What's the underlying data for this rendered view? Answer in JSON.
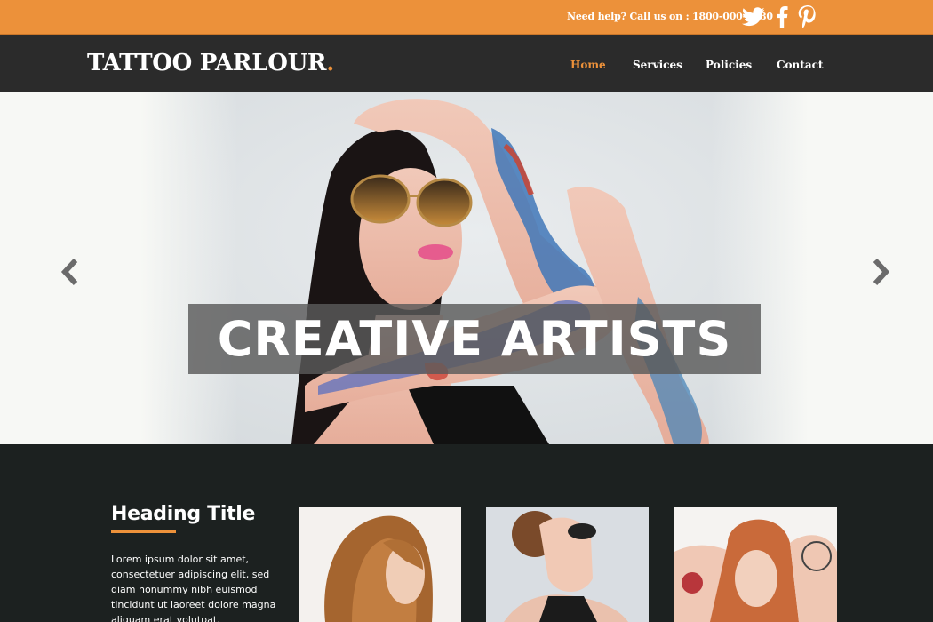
{
  "topbar": {
    "help_text": "Need help? Call us on : 1800-000-8080",
    "social": [
      {
        "name": "twitter-icon"
      },
      {
        "name": "facebook-icon"
      },
      {
        "name": "pinterest-icon"
      }
    ]
  },
  "header": {
    "logo_text": "TATTOO PARLOUR",
    "logo_dot": ".",
    "nav": [
      {
        "label": "Home",
        "active": true
      },
      {
        "label": "Services",
        "active": false
      },
      {
        "label": "Policies",
        "active": false
      },
      {
        "label": "Contact",
        "active": false
      }
    ]
  },
  "hero": {
    "caption": "CREATIVE ARTISTS",
    "prev_icon": "chevron-left-icon",
    "next_icon": "chevron-right-icon"
  },
  "content": {
    "heading": "Heading Title",
    "body": "Lorem ipsum dolor sit amet, consectetuer adipiscing elit, sed diam nonummy nibh euismod tincidunt ut laoreet dolore magna aliquam erat volutpat."
  },
  "colors": {
    "accent": "#ec913a",
    "nav_bg": "#2b2b2b",
    "content_bg": "#1c2120"
  }
}
